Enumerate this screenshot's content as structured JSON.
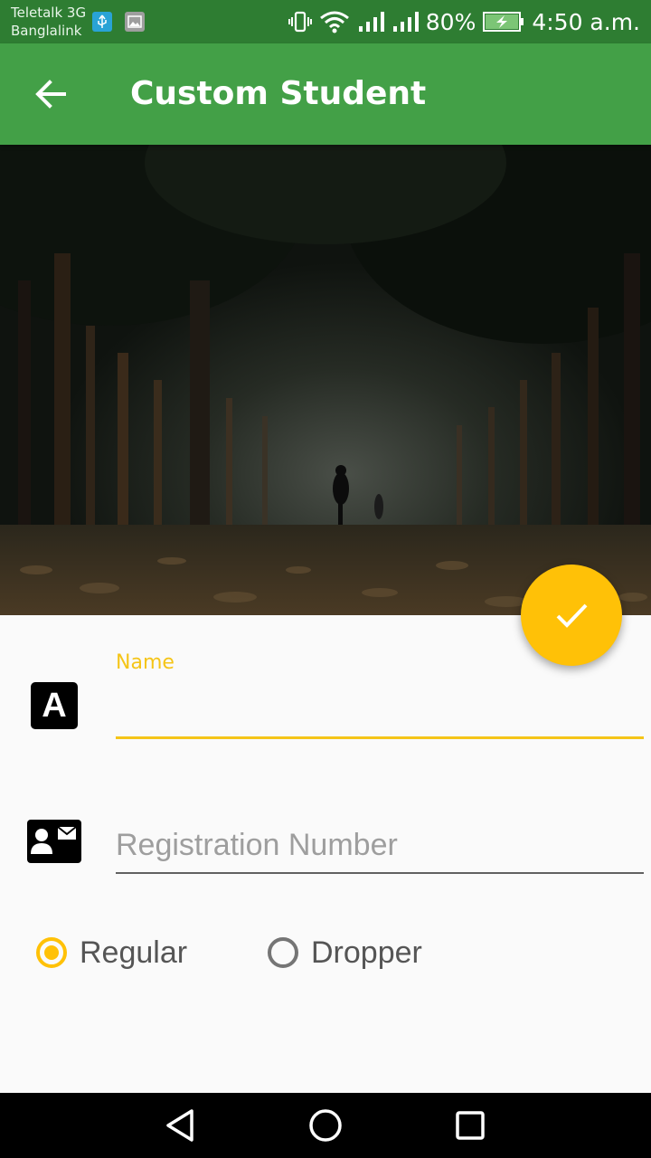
{
  "status_bar": {
    "carrier_1": "Teletalk 3G",
    "carrier_2": "Banglalink",
    "battery": "80%",
    "time": "4:50 a.m.",
    "icons": [
      "usb-icon",
      "gallery-icon",
      "vibrate-icon",
      "wifi-icon",
      "signal-icon",
      "signal-icon",
      "battery-charging-icon"
    ]
  },
  "app_bar": {
    "title": "Custom Student",
    "back_icon": "arrow-left-icon",
    "color": "#43a047"
  },
  "fab": {
    "icon": "check-icon",
    "color": "#ffc107"
  },
  "form": {
    "name": {
      "label": "Name",
      "value": "",
      "icon": "text-a-icon"
    },
    "registration": {
      "placeholder": "Registration Number",
      "value": "",
      "icon": "contact-card-icon"
    },
    "student_type": {
      "options": [
        "Regular",
        "Dropper"
      ],
      "selected": "Regular"
    }
  },
  "colors": {
    "accent": "#ffc107",
    "primary_dark": "#2e7d32",
    "primary": "#43a047"
  }
}
